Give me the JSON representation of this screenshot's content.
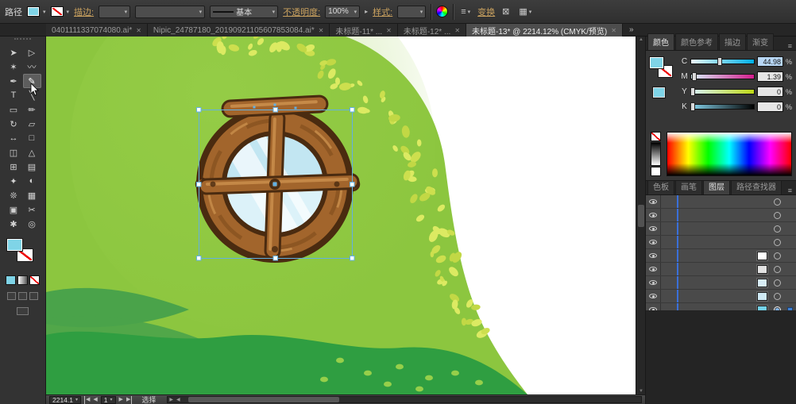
{
  "control_bar": {
    "object_label": "路径",
    "stroke_label": "描边:",
    "brush_preview": "基本",
    "opacity_label": "不透明度:",
    "opacity_value": "100%",
    "style_label": "样式:",
    "transform_label": "变换",
    "link_color": "#c9a15f"
  },
  "tab_bar": {
    "close_icon": "✕",
    "overflow_icon": "»",
    "tabs": [
      {
        "label": "0401111337074080.ai*",
        "active": false
      },
      {
        "label": "Nipic_24787180_20190921105607853084.ai*",
        "active": false
      },
      {
        "label": "未标题-11* ...",
        "active": false
      },
      {
        "label": "未标题-12* ...",
        "active": false
      },
      {
        "label": "未标题-13* @ 2214.12% (CMYK/预览)",
        "active": true
      }
    ]
  },
  "toolbar": {
    "fill_color": "#7fd4e7",
    "stroke": "none",
    "tools": [
      {
        "name": "selection-tool",
        "glyph": "➤",
        "active": false
      },
      {
        "name": "direct-selection-tool",
        "glyph": "▷",
        "active": false
      },
      {
        "name": "magic-wand-tool",
        "glyph": "✶",
        "active": false
      },
      {
        "name": "lasso-tool",
        "glyph": "〰",
        "active": false
      },
      {
        "name": "pen-tool",
        "glyph": "✒",
        "active": false
      },
      {
        "name": "paintbrush-tool",
        "glyph": "✎",
        "active": true
      },
      {
        "name": "type-tool",
        "glyph": "T",
        "active": false
      },
      {
        "name": "line-segment-tool",
        "glyph": "╲",
        "active": false
      },
      {
        "name": "rectangle-tool",
        "glyph": "▭",
        "active": false
      },
      {
        "name": "pencil-tool",
        "glyph": "✏",
        "active": false
      },
      {
        "name": "rotate-tool",
        "glyph": "↻",
        "active": false
      },
      {
        "name": "scale-tool",
        "glyph": "▱",
        "active": false
      },
      {
        "name": "width-tool",
        "glyph": "↔",
        "active": false
      },
      {
        "name": "free-transform-tool",
        "glyph": "□",
        "active": false
      },
      {
        "name": "shape-builder-tool",
        "glyph": "◫",
        "active": false
      },
      {
        "name": "perspective-grid-tool",
        "glyph": "△",
        "active": false
      },
      {
        "name": "mesh-tool",
        "glyph": "⊞",
        "active": false
      },
      {
        "name": "gradient-tool",
        "glyph": "▤",
        "active": false
      },
      {
        "name": "eyedropper-tool",
        "glyph": "✦",
        "active": false
      },
      {
        "name": "blend-tool",
        "glyph": "◐",
        "active": false
      },
      {
        "name": "symbol-sprayer-tool",
        "glyph": "❊",
        "active": false
      },
      {
        "name": "graph-tool",
        "glyph": "▦",
        "active": false
      },
      {
        "name": "artboard-tool",
        "glyph": "▣",
        "active": false
      },
      {
        "name": "slice-tool",
        "glyph": "✂",
        "active": false
      },
      {
        "name": "hand-tool",
        "glyph": "✱",
        "active": false
      },
      {
        "name": "zoom-tool",
        "glyph": "◎",
        "active": false
      }
    ]
  },
  "color_panel": {
    "tabs": [
      {
        "label": "颜色",
        "active": true
      },
      {
        "label": "颜色参考",
        "active": false
      },
      {
        "label": "描边",
        "active": false
      },
      {
        "label": "渐变",
        "active": false
      }
    ],
    "fill_color": "#7fd4e7",
    "sliders": [
      {
        "channel": "C",
        "value": "44.98",
        "unit": "%",
        "position_pct": 45,
        "selected": true
      },
      {
        "channel": "M",
        "value": "1.39",
        "unit": "%",
        "position_pct": 5,
        "selected": false
      },
      {
        "channel": "Y",
        "value": "0",
        "unit": "%",
        "position_pct": 2,
        "selected": false
      },
      {
        "channel": "K",
        "value": "0",
        "unit": "%",
        "position_pct": 2,
        "selected": false
      }
    ]
  },
  "layers_panel": {
    "tabs": [
      {
        "label": "色板",
        "active": false
      },
      {
        "label": "画笔",
        "active": false
      },
      {
        "label": "图层",
        "active": true
      },
      {
        "label": "路径查找器",
        "active": false
      }
    ],
    "accent_color": "#3a6fd8",
    "rows": [
      {
        "thumb": null,
        "selected": false
      },
      {
        "thumb": null,
        "selected": false
      },
      {
        "thumb": null,
        "selected": false
      },
      {
        "thumb": null,
        "selected": false
      },
      {
        "thumb": "#ffffff",
        "selected": false
      },
      {
        "thumb": "#e2e2e2",
        "selected": false
      },
      {
        "thumb": "#d8edf6",
        "selected": false
      },
      {
        "thumb": "#cfe9f4",
        "selected": false
      },
      {
        "thumb": "#74d2e8",
        "selected": true
      }
    ]
  },
  "status_bar": {
    "zoom_value": "2214.1",
    "artboard_value": "1",
    "status_text": "选择",
    "icons": {
      "first": "◀",
      "prev": "◀",
      "next": "▶",
      "last": "▶",
      "scroll_left": "◀",
      "scroll_right": "▶"
    }
  },
  "artwork": {
    "selection_color": "#62b0e3",
    "colors": {
      "canopy": "#8cc63f",
      "leaf_light": "#cddf4e",
      "leaf_lighter": "#dcea62",
      "dark_leaf": "#4aa34a",
      "dark_band": "#2f9e41",
      "band_dot": "#96cf4a",
      "wood_dark": "#4a2b10",
      "wood": "#a2652c",
      "wood_highlight": "#cf9450",
      "glass": "#c2e6f2",
      "glass_light": "#dff3f9"
    }
  }
}
